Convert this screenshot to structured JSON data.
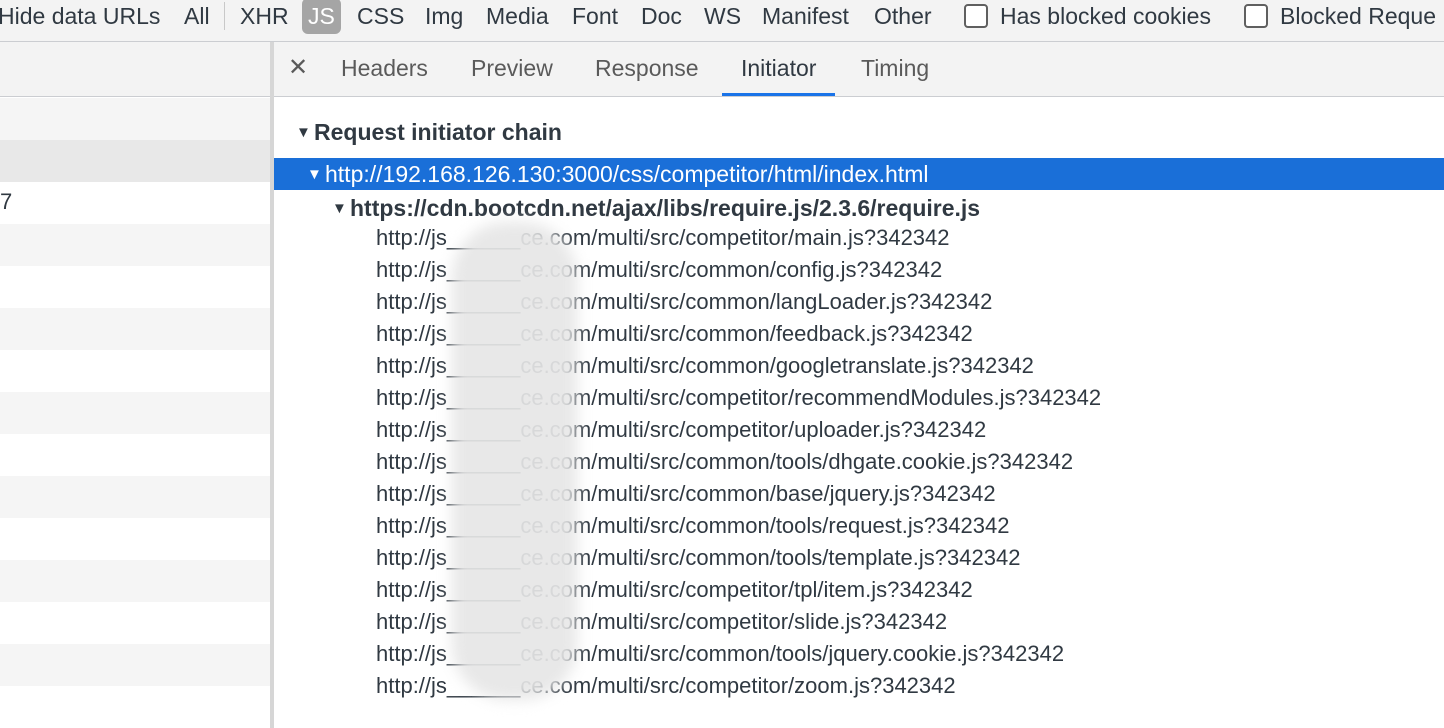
{
  "filter_bar": {
    "items": [
      "Hide data URLs",
      "All",
      "XHR",
      "JS",
      "CSS",
      "Img",
      "Media",
      "Font",
      "Doc",
      "WS",
      "Manifest",
      "Other"
    ],
    "active": "JS",
    "checkboxes": [
      "Has blocked cookies",
      "Blocked Reque"
    ]
  },
  "request_list": {
    "partial_text": "7"
  },
  "details": {
    "close_icon": "close-icon",
    "tabs": [
      "Headers",
      "Preview",
      "Response",
      "Initiator",
      "Timing"
    ],
    "active_tab": "Initiator",
    "section_title": "Request initiator chain",
    "root_url": "http://192.168.126.130:3000/css/competitor/html/index.html",
    "child_url": "https://cdn.bootcdn.net/ajax/libs/require.js/2.3.6/require.js",
    "leaves": [
      "http://js______ce.com/multi/src/competitor/main.js?342342",
      "http://js______ce.com/multi/src/common/config.js?342342",
      "http://js______ce.com/multi/src/common/langLoader.js?342342",
      "http://js______ce.com/multi/src/common/feedback.js?342342",
      "http://js______ce.com/multi/src/common/googletranslate.js?342342",
      "http://js______ce.com/multi/src/competitor/recommendModules.js?342342",
      "http://js______ce.com/multi/src/competitor/uploader.js?342342",
      "http://js______ce.com/multi/src/common/tools/dhgate.cookie.js?342342",
      "http://js______ce.com/multi/src/common/base/jquery.js?342342",
      "http://js______ce.com/multi/src/common/tools/request.js?342342",
      "http://js______ce.com/multi/src/common/tools/template.js?342342",
      "http://js______ce.com/multi/src/competitor/tpl/item.js?342342",
      "http://js______ce.com/multi/src/competitor/slide.js?342342",
      "http://js______ce.com/multi/src/common/tools/jquery.cookie.js?342342",
      "http://js______ce.com/multi/src/competitor/zoom.js?342342"
    ]
  },
  "colors": {
    "accent": "#1a73e8",
    "selection": "#1a6fd8",
    "toolbar": "#f3f3f3"
  }
}
